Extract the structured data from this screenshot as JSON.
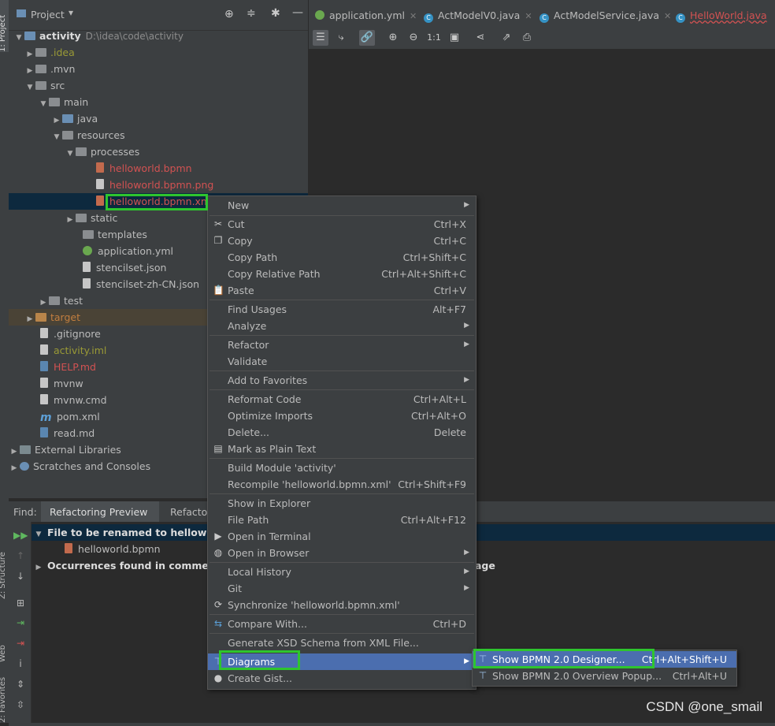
{
  "left_strip": {
    "project": "1: Project",
    "structure": "Z: Structure",
    "web": "Web",
    "favorites": "2: Favorites"
  },
  "project_header": {
    "title": "Project",
    "dropdown": "▾"
  },
  "tree": {
    "activity": {
      "name": "activity",
      "path": "D:\\idea\\code\\activity"
    },
    "idea": ".idea",
    "mvn": ".mvn",
    "src": "src",
    "main": "main",
    "java": "java",
    "resources": "resources",
    "processes": "processes",
    "f1": "helloworld.bpmn",
    "f2": "helloworld.bpmn.png",
    "f3": "helloworld.bpmn.xml",
    "static": "static",
    "templates": "templates",
    "appyml": "application.yml",
    "stencil": "stencilset.json",
    "stencilcn": "stencilset-zh-CN.json",
    "test": "test",
    "target": "target",
    "gitignore": ".gitignore",
    "iml": "activity.iml",
    "help": "HELP.md",
    "mvnw": "mvnw",
    "mvnwcmd": "mvnw.cmd",
    "pom": "pom.xml",
    "read": "read.md",
    "extlib": "External Libraries",
    "scratches": "Scratches and Consoles"
  },
  "editor_tabs": [
    "application.yml",
    "ActModelV0.java",
    "ActModelService.java",
    "HelloWorld.java"
  ],
  "toolbar": {
    "zoom_actual": "1:1"
  },
  "find": {
    "label": "Find:",
    "tab1": "Refactoring Preview",
    "tab2": "Refactor",
    "row1": "File to be renamed to helloworld",
    "row2": "helloworld.bpmn",
    "row3": "Occurrences found in comments,",
    "row3_tail": "age"
  },
  "menu": {
    "new": "New",
    "cut": "Cut",
    "cut_sc": "Ctrl+X",
    "copy": "Copy",
    "copy_sc": "Ctrl+C",
    "copy_path": "Copy Path",
    "copy_path_sc": "Ctrl+Shift+C",
    "copy_rel": "Copy Relative Path",
    "copy_rel_sc": "Ctrl+Alt+Shift+C",
    "paste": "Paste",
    "paste_sc": "Ctrl+V",
    "find_usages": "Find Usages",
    "find_usages_sc": "Alt+F7",
    "analyze": "Analyze",
    "refactor": "Refactor",
    "validate": "Validate",
    "favorites": "Add to Favorites",
    "reformat": "Reformat Code",
    "reformat_sc": "Ctrl+Alt+L",
    "optimize": "Optimize Imports",
    "optimize_sc": "Ctrl+Alt+O",
    "delete": "Delete...",
    "delete_sc": "Delete",
    "plain": "Mark as Plain Text",
    "build": "Build Module 'activity'",
    "recompile": "Recompile 'helloworld.bpmn.xml'",
    "recompile_sc": "Ctrl+Shift+F9",
    "explorer": "Show in Explorer",
    "filepath": "File Path",
    "filepath_sc": "Ctrl+Alt+F12",
    "terminal": "Open in Terminal",
    "browser": "Open in Browser",
    "history": "Local History",
    "git": "Git",
    "sync": "Synchronize 'helloworld.bpmn.xml'",
    "compare": "Compare With...",
    "compare_sc": "Ctrl+D",
    "xsd": "Generate XSD Schema from XML File...",
    "diagrams": "Diagrams",
    "gist": "Create Gist..."
  },
  "submenu": {
    "designer": "Show BPMN 2.0 Designer...",
    "designer_sc": "Ctrl+Alt+Shift+U",
    "overview": "Show BPMN 2.0 Overview Popup...",
    "overview_sc": "Ctrl+Alt+U"
  },
  "watermark": "CSDN @one_smail",
  "colors": {
    "selection": "#0d293e",
    "menu_highlight": "#4b6eaf",
    "annotation_box": "#2ec52e"
  }
}
